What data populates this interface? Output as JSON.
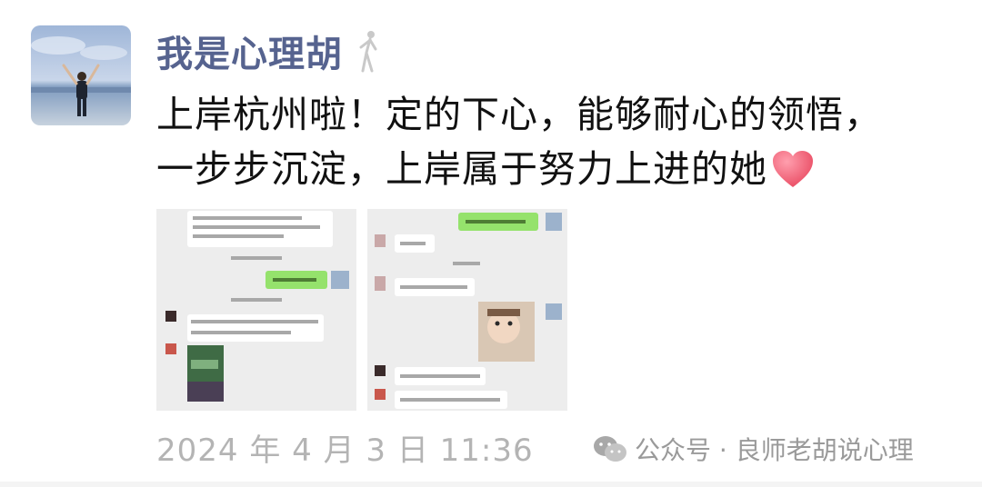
{
  "post": {
    "author": "我是心理胡",
    "text_line1": "上岸杭州啦！定的下心，能够耐心的领悟，",
    "text_line2": "一步步沉淀，上岸属于努力上进的她",
    "timestamp": "2024 年 4 月 3 日 11:36"
  },
  "icons": {
    "author_badge": "person-figure-icon",
    "heart": "heart-emoji-icon",
    "watermark": "wechat-icon"
  },
  "watermark": {
    "text": "公众号 · 良师老胡说心理"
  },
  "images": [
    {
      "label": "chat-screenshot-1"
    },
    {
      "label": "chat-screenshot-2"
    }
  ],
  "colors": {
    "author_name": "#56638f",
    "text": "#111111",
    "timestamp": "#b4b4b4",
    "chat_green": "#95e26c"
  }
}
